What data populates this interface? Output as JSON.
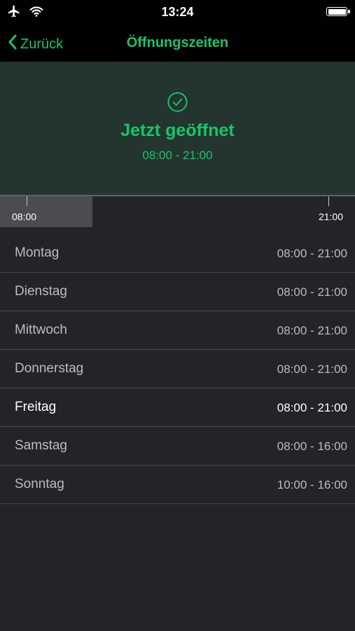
{
  "status_bar": {
    "time": "13:24",
    "airplane_icon": "airplane-icon",
    "wifi_icon": "wifi-icon",
    "battery_icon": "battery-icon"
  },
  "nav": {
    "back_label": "Zurück",
    "title": "Öffnungszeiten"
  },
  "hero": {
    "status": "Jetzt geöffnet",
    "range": "08:00 - 21:00",
    "icon": "check-circle-icon"
  },
  "timeline": {
    "start_label": "08:00",
    "end_label": "21:00",
    "progress_fraction": 0.26
  },
  "days": [
    {
      "name": "Montag",
      "hours": "08:00 - 21:00"
    },
    {
      "name": "Dienstag",
      "hours": "08:00 - 21:00"
    },
    {
      "name": "Mittwoch",
      "hours": "08:00 - 21:00"
    },
    {
      "name": "Donnerstag",
      "hours": "08:00 - 21:00"
    },
    {
      "name": "Freitag",
      "hours": "08:00 - 21:00",
      "today": true
    },
    {
      "name": "Samstag",
      "hours": "08:00 - 16:00"
    },
    {
      "name": "Sonntag",
      "hours": "10:00 - 16:00"
    }
  ],
  "colors": {
    "accent": "#17c66a",
    "background": "#232427",
    "hero_background": "#243530"
  }
}
